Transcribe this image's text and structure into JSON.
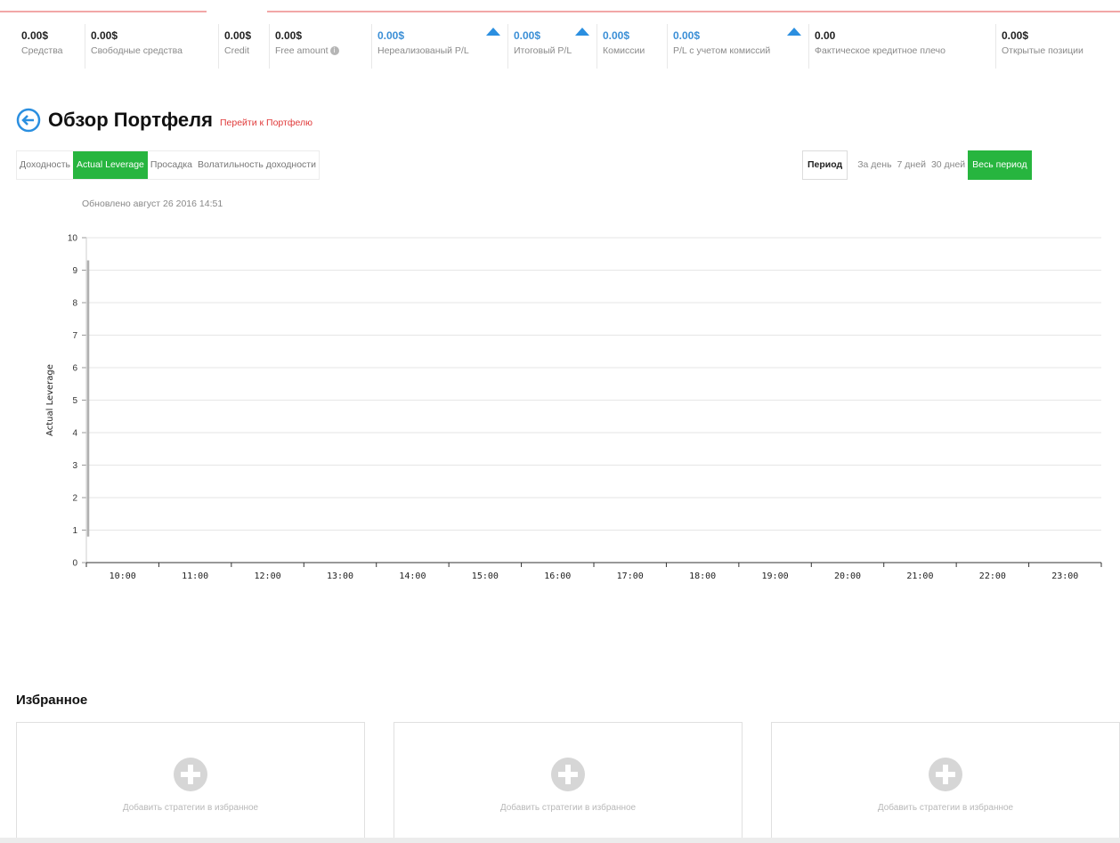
{
  "stats": [
    {
      "value": "0.00$",
      "label": "Средства",
      "blue": false,
      "arrow": false,
      "info": false
    },
    {
      "value": "0.00$",
      "label": "Свободные средства",
      "blue": false,
      "arrow": false,
      "info": false
    },
    {
      "value": "0.00$",
      "label": "Credit",
      "blue": false,
      "arrow": false,
      "info": false
    },
    {
      "value": "0.00$",
      "label": "Free amount",
      "blue": false,
      "arrow": false,
      "info": true
    },
    {
      "value": "0.00$",
      "label": "Нереализованый P/L",
      "blue": true,
      "arrow": true,
      "info": false
    },
    {
      "value": "0.00$",
      "label": "Итоговый P/L",
      "blue": true,
      "arrow": true,
      "info": false
    },
    {
      "value": "0.00$",
      "label": "Комиссии",
      "blue": true,
      "arrow": false,
      "info": false
    },
    {
      "value": "0.00$",
      "label": "P/L с учетом комиссий",
      "blue": true,
      "arrow": true,
      "info": false
    },
    {
      "value": "0.00",
      "label": "Фактическое кредитное плечо",
      "blue": false,
      "arrow": false,
      "info": false
    },
    {
      "value": "0.00$",
      "label": "Открытые позиции",
      "blue": false,
      "arrow": false,
      "info": false
    }
  ],
  "header": {
    "title": "Обзор Портфеля",
    "link": "Перейти к Портфелю"
  },
  "tabs": [
    {
      "label": "Доходность",
      "active": false
    },
    {
      "label": "Actual Leverage",
      "active": true
    },
    {
      "label": "Просадка",
      "active": false
    },
    {
      "label": "Волатильность доходности",
      "active": false
    }
  ],
  "period": {
    "label": "Период",
    "options": [
      {
        "label": "За день",
        "active": false
      },
      {
        "label": "7 дней",
        "active": false
      },
      {
        "label": "30 дней",
        "active": false
      },
      {
        "label": "Весь период",
        "active": true
      }
    ]
  },
  "updated": "Обновлено август 26 2016 14:51",
  "chart_data": {
    "type": "line",
    "ylabel": "Actual Leverage",
    "xlabel": "",
    "ylim": [
      0,
      10
    ],
    "yticks": [
      0,
      1,
      2,
      3,
      4,
      5,
      6,
      7,
      8,
      9,
      10
    ],
    "categories": [
      "10:00",
      "11:00",
      "12:00",
      "13:00",
      "14:00",
      "15:00",
      "16:00",
      "17:00",
      "18:00",
      "19:00",
      "20:00",
      "21:00",
      "22:00",
      "23:00"
    ],
    "series": [
      {
        "color": "#b0b0b0",
        "points": [
          {
            "x": "10:00",
            "y": 0.8
          },
          {
            "x": "10:00",
            "y": 9.3
          }
        ]
      }
    ],
    "grid": true
  },
  "favorites": {
    "title": "Избранное",
    "cards": [
      {
        "text": "Добавить стратегии в избранное"
      },
      {
        "text": "Добавить стратегии в избранное"
      },
      {
        "text": "Добавить стратегии в избранное"
      }
    ]
  },
  "colors": {
    "accent": "#27b53f",
    "link": "#e03a3a",
    "blue_value": "#3b8fd6",
    "arrow": "#2b8fe0"
  }
}
